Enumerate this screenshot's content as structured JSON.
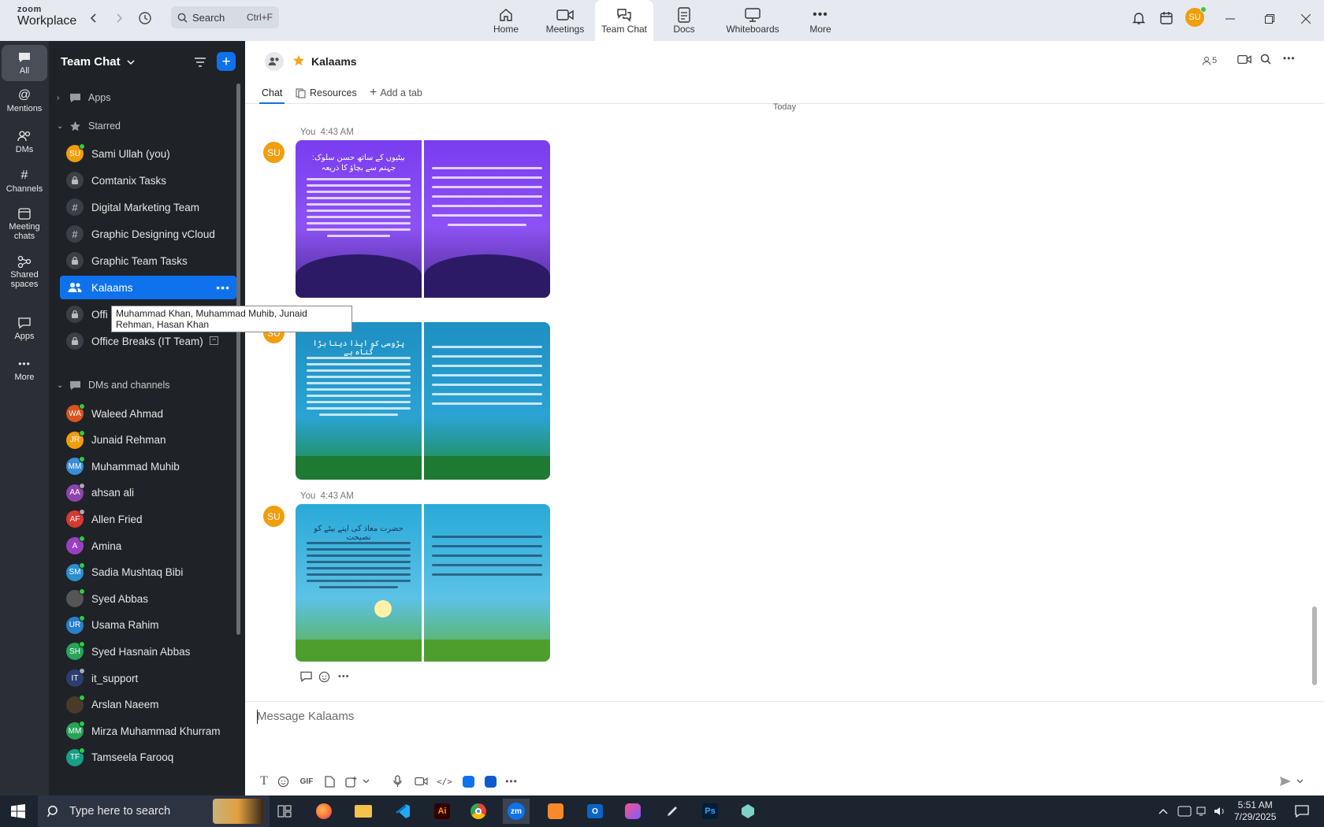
{
  "app": {
    "logo_line1": "zoom",
    "logo_line2": "Workplace"
  },
  "search": {
    "placeholder": "Search",
    "shortcut": "Ctrl+F"
  },
  "topnav": [
    {
      "label": "Home"
    },
    {
      "label": "Meetings"
    },
    {
      "label": "Team Chat"
    },
    {
      "label": "Docs"
    },
    {
      "label": "Whiteboards"
    },
    {
      "label": "More"
    }
  ],
  "user": {
    "initials": "SU"
  },
  "rail": [
    {
      "label": "All"
    },
    {
      "label": "Mentions"
    },
    {
      "label": "DMs"
    },
    {
      "label": "Channels"
    },
    {
      "label": "Meeting chats"
    },
    {
      "label": "Shared spaces"
    },
    {
      "label": "Apps"
    },
    {
      "label": "More"
    }
  ],
  "sidebar": {
    "title": "Team Chat",
    "sections": {
      "apps": "Apps",
      "starred": "Starred",
      "dms": "DMs and channels"
    },
    "starred": [
      {
        "name": "Sami Ullah (you)",
        "initials": "SU",
        "color": "#f29d0c"
      },
      {
        "name": "Comtanix Tasks"
      },
      {
        "name": "Digital Marketing Team"
      },
      {
        "name": "Graphic Designing vCloud"
      },
      {
        "name": "Graphic Team Tasks"
      },
      {
        "name": "Kalaams"
      },
      {
        "name": "Offi"
      },
      {
        "name": "Office Breaks (IT Team)"
      }
    ],
    "dms": [
      {
        "name": "Waleed Ahmad",
        "initials": "WA",
        "color": "#d9531e"
      },
      {
        "name": "Junaid Rehman",
        "initials": "JR",
        "color": "#f29d0c"
      },
      {
        "name": "Muhammad Muhib",
        "initials": "MM",
        "color": "#3a8dd6"
      },
      {
        "name": "ahsan ali",
        "initials": "AA",
        "color": "#8e44ad"
      },
      {
        "name": "Allen Fried",
        "initials": "AF",
        "color": "#d63a2f"
      },
      {
        "name": "Amina",
        "initials": "A",
        "color": "#9b3fc1"
      },
      {
        "name": "Sadia Mushtaq Bibi",
        "initials": "SM",
        "color": "#2a8fd0"
      },
      {
        "name": "Syed Abbas",
        "initials": "",
        "color": "#555"
      },
      {
        "name": "Usama Rahim",
        "initials": "UR",
        "color": "#2a7fc9"
      },
      {
        "name": "Syed Hasnain Abbas",
        "initials": "SH",
        "color": "#27a35a"
      },
      {
        "name": "it_support",
        "initials": "IT",
        "color": "#2c3e70"
      },
      {
        "name": "Arslan Naeem",
        "initials": "",
        "color": "#4a3a2a"
      },
      {
        "name": "Mirza Muhammad Khurram",
        "initials": "MM",
        "color": "#27a35a"
      },
      {
        "name": "Tamseela Farooq",
        "initials": "TF",
        "color": "#16a085"
      }
    ],
    "tooltip": "Muhammad Khan, Muhammad Muhib, Junaid Rehman, Hasan Khan"
  },
  "channel": {
    "name": "Kalaams",
    "members": "5",
    "tabs": {
      "chat": "Chat",
      "resources": "Resources",
      "add": "Add a tab"
    }
  },
  "chat": {
    "date_separator": "Today",
    "messages": [
      {
        "sender": "You",
        "time": "4:43 AM",
        "initials": "SU"
      },
      {
        "initials": "SU"
      },
      {
        "sender": "You",
        "time": "4:43 AM",
        "initials": "SU"
      }
    ],
    "image_titles": [
      "بیٹیوں کے ساتھ حسن سلوک: جہنم سے بچاؤ کا ذریعہ",
      "پڑوسی کو ایذا دینا بڑا گناہ ہے",
      "حضرت معاذ کی اپنے بیٹے کو نصیحت"
    ]
  },
  "composer": {
    "placeholder": "Message Kalaams",
    "gif": "GIF"
  },
  "taskbar": {
    "search_placeholder": "Type here to search",
    "time": "5:51 AM",
    "date": "7/29/2025"
  },
  "colors": {
    "accent": "#0e72ed",
    "rail": "#2b2e34",
    "sidebar": "#1f2227",
    "online": "#2ecc40"
  }
}
